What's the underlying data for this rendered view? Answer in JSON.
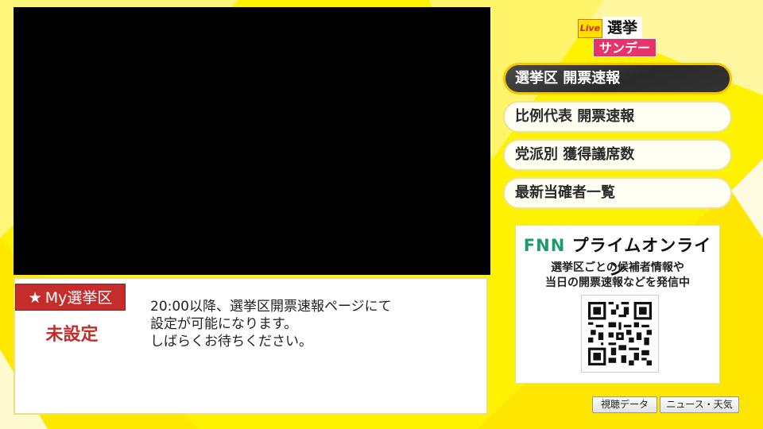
{
  "logo": {
    "live": "Live",
    "top": "選挙",
    "bottom": "サンデー"
  },
  "menu": {
    "items": [
      {
        "label": "選挙区 開票速報",
        "active": true
      },
      {
        "label": "比例代表 開票速報",
        "active": false
      },
      {
        "label": "党派別 獲得議席数",
        "active": false
      },
      {
        "label": "最新当確者一覧",
        "active": false
      }
    ]
  },
  "my_district": {
    "badge": "My選挙区",
    "star_icon": "star-icon",
    "status": "未設定",
    "notice": "20:00以降、選挙区開票速報ページにて\n設定が可能になります。\nしばらくお待ちください。"
  },
  "fnn": {
    "title_fnn": "FNN",
    "title_rest": "プライムオンライン",
    "description": "選挙区ごとの候補者情報や\n当日の開票速報などを発信中",
    "qr_icon": "qr-code-icon"
  },
  "footer": {
    "viewing_data": "視聴データ",
    "news_weather": "ニュース・天気"
  },
  "colors": {
    "background": "#fff200",
    "accent_red": "#c42d2b",
    "active_border": "#f3c400",
    "logo_pink": "#e8336a"
  }
}
